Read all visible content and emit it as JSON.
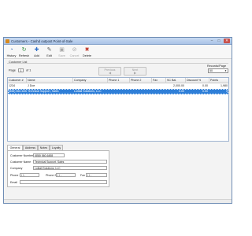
{
  "window": {
    "title": "Customers - Cashd outpost Point-of-Sale",
    "controls": {
      "minimize": "–",
      "maximize": "□",
      "close": "✕"
    }
  },
  "toolbar": {
    "items": [
      {
        "label": "History",
        "icon": "history-icon",
        "glyph": "◔",
        "color": "#3a6db5"
      },
      {
        "label": "Refresh",
        "icon": "refresh-icon",
        "glyph": "↻",
        "color": "#2e8b3d"
      },
      {
        "label": "Add",
        "icon": "add-icon",
        "glyph": "✚",
        "color": "#2f6fc8"
      },
      {
        "label": "Edit",
        "icon": "edit-icon",
        "glyph": "✎",
        "color": "#5a5a5a"
      },
      {
        "label": "Save",
        "icon": "save-icon",
        "glyph": "▣",
        "color": "#a8a8a8"
      },
      {
        "label": "Cancel",
        "icon": "cancel-icon",
        "glyph": "⊘",
        "color": "#a8a8a8"
      },
      {
        "label": "Delete",
        "icon": "delete-icon",
        "glyph": "✖",
        "color": "#c0392b"
      }
    ]
  },
  "list": {
    "group_label": "Customer List",
    "pager": {
      "page_label": "Page",
      "page": "1",
      "of_label": "of 1"
    },
    "previous": {
      "label": "Previous",
      "arrow": "◀"
    },
    "next": {
      "label": "Next",
      "arrow": "▶"
    },
    "records_label": "Records/Page",
    "records_per_page": "50",
    "columns": [
      "Customer #",
      "Name",
      "Company",
      "Phone 1",
      "Phone 2",
      "Fax",
      "SC Bal.",
      "Discount %",
      "Points"
    ],
    "rows": [
      {
        "customer_no": "1234",
        "name": "J Doe",
        "company": "",
        "phone1": "",
        "phone2": "",
        "fax": "",
        "sc_bal": "2,000.00",
        "discount": "0.00",
        "points": "1,980"
      },
      {
        "customer_no": "(858) 560-6458",
        "name": "Technical Support, Sales",
        "company": "Loitiall Solutions, LLC",
        "phone1": "",
        "phone2": "",
        "fax": "",
        "sc_bal": "0.00",
        "discount": "0.00",
        "points": "0"
      }
    ],
    "selected_row": 1
  },
  "detail": {
    "tabs": [
      "General",
      "Address",
      "Notes",
      "Loyalty"
    ],
    "active_tab": "General",
    "fields": {
      "customer_number_label": "Customer Number",
      "customer_number": "(858) 560-6458",
      "customer_name_label": "Customer Name",
      "customer_name": "Technical Support, Sales",
      "company_label": "Company",
      "company": "Loitiall Solutions, LLC",
      "phone1_label": "Phone 1",
      "phone1": "( )  -",
      "phone2_label": "Phone 2",
      "phone2": "( )  -",
      "fax_label": "Fax",
      "fax": "( )  -",
      "email_label": "Email",
      "email": ""
    }
  },
  "colors": {
    "selection": "#2f7fd8",
    "titlebar": "#b9cfee"
  }
}
